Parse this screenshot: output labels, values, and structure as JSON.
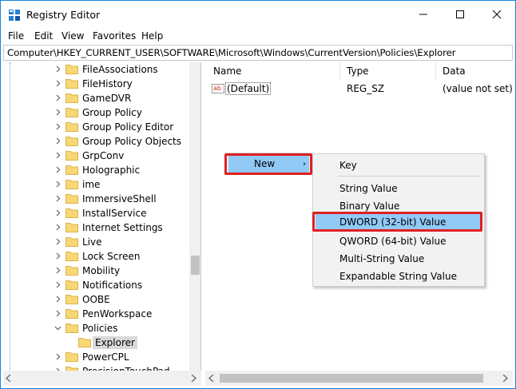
{
  "window": {
    "title": "Registry Editor",
    "controls": [
      "minimize",
      "maximize",
      "close"
    ]
  },
  "menu": [
    "File",
    "Edit",
    "View",
    "Favorites",
    "Help"
  ],
  "address": "Computer\\HKEY_CURRENT_USER\\SOFTWARE\\Microsoft\\Windows\\CurrentVersion\\Policies\\Explorer",
  "tree": [
    {
      "label": "FileAssociations",
      "expanded": false
    },
    {
      "label": "FileHistory",
      "expanded": false
    },
    {
      "label": "GameDVR",
      "expanded": false
    },
    {
      "label": "Group Policy",
      "expanded": false
    },
    {
      "label": "Group Policy Editor",
      "expanded": false
    },
    {
      "label": "Group Policy Objects",
      "expanded": false
    },
    {
      "label": "GrpConv",
      "expanded": false
    },
    {
      "label": "Holographic",
      "expanded": false
    },
    {
      "label": "ime",
      "expanded": false
    },
    {
      "label": "ImmersiveShell",
      "expanded": false
    },
    {
      "label": "InstallService",
      "expanded": false
    },
    {
      "label": "Internet Settings",
      "expanded": false
    },
    {
      "label": "Live",
      "expanded": false
    },
    {
      "label": "Lock Screen",
      "expanded": false
    },
    {
      "label": "Mobility",
      "expanded": false
    },
    {
      "label": "Notifications",
      "expanded": false
    },
    {
      "label": "OOBE",
      "expanded": false
    },
    {
      "label": "PenWorkspace",
      "expanded": false
    },
    {
      "label": "Policies",
      "expanded": true
    },
    {
      "label": "Explorer",
      "selected": true,
      "child": true
    },
    {
      "label": "PowerCPL",
      "expanded": false
    },
    {
      "label": "PrecisionTouchPad",
      "expanded": false
    }
  ],
  "list": {
    "columns": [
      "Name",
      "Type",
      "Data"
    ],
    "rows": [
      {
        "name": "(Default)",
        "type": "REG_SZ",
        "data": "(value not set)",
        "icon": "string-value-icon"
      }
    ]
  },
  "context_menu": {
    "new_label": "New",
    "submenu": {
      "key": "Key",
      "items": [
        "String Value",
        "Binary Value",
        "DWORD (32-bit) Value",
        "QWORD (64-bit) Value",
        "Multi-String Value",
        "Expandable String Value"
      ],
      "highlighted": "DWORD (32-bit) Value"
    }
  },
  "colors": {
    "window_border": "#1883d7",
    "menu_highlight": "#91c9f7",
    "annotation_red": "#e02020",
    "folder_yellow": "#f8d775"
  }
}
